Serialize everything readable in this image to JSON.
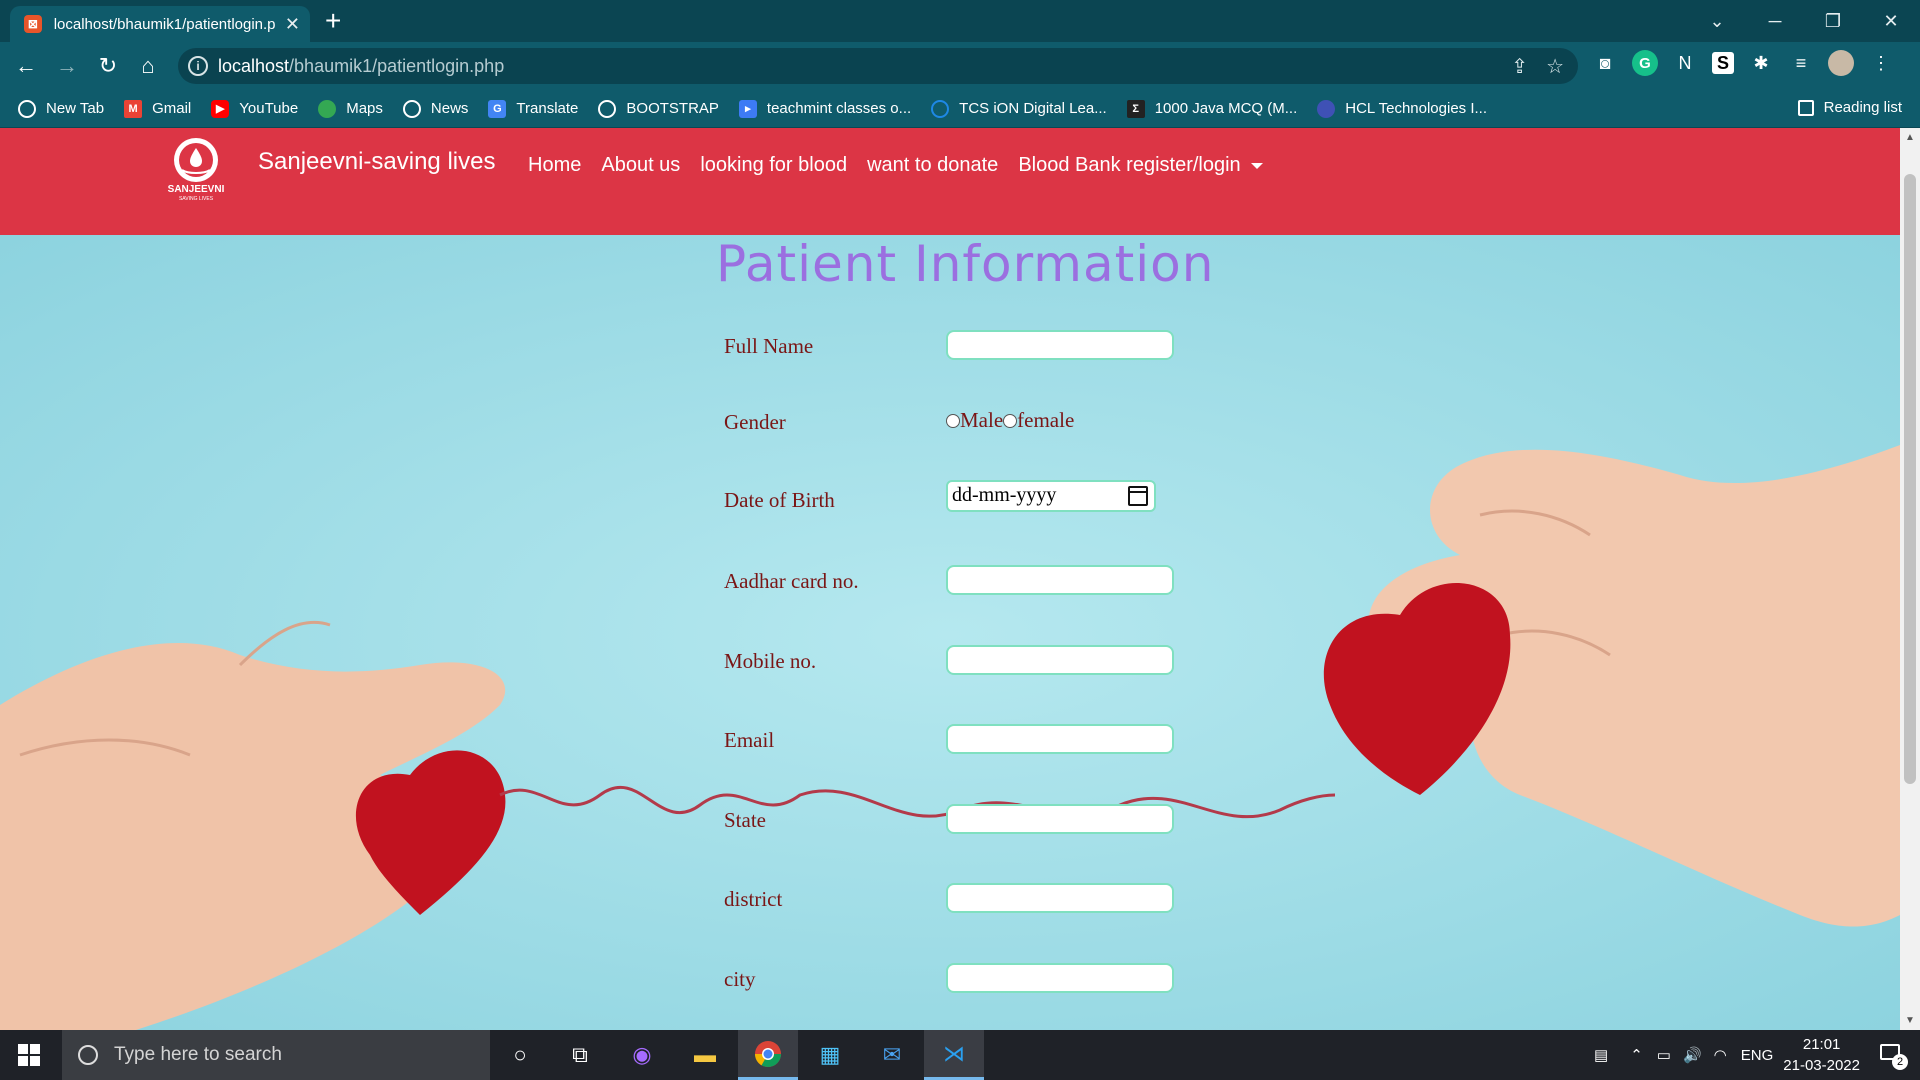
{
  "browser": {
    "tab_title": "localhost/bhaumik1/patientlogin.php",
    "url_host": "localhost",
    "url_path": "/bhaumik1/patientlogin.php",
    "bookmarks": [
      {
        "label": "New Tab",
        "color": "#ffffff"
      },
      {
        "label": "Gmail",
        "color": "#ea4335"
      },
      {
        "label": "YouTube",
        "color": "#ff0000"
      },
      {
        "label": "Maps",
        "color": "#34a853"
      },
      {
        "label": "News",
        "color": "#ffffff"
      },
      {
        "label": "Translate",
        "color": "#4285f4"
      },
      {
        "label": "BOOTSTRAP",
        "color": "#ffffff"
      },
      {
        "label": "teachmint classes o...",
        "color": "#3d7bf5"
      },
      {
        "label": "TCS iON Digital Lea...",
        "color": "#1e88e5"
      },
      {
        "label": "1000 Java MCQ (M...",
        "color": "#222222"
      },
      {
        "label": "HCL Technologies I...",
        "color": "#3f51b5"
      }
    ],
    "reading_list": "Reading list"
  },
  "site": {
    "brand": "Sanjeevni-saving lives",
    "logo_text": "SANJEEVNI",
    "logo_subtext": "SAVING LIVES",
    "nav": {
      "home": "Home",
      "about": "About us",
      "looking": "looking for blood",
      "donate": "want to donate",
      "bloodbank": "Blood Bank register/login"
    },
    "accent_color": "#dc3545"
  },
  "form": {
    "title": "Patient Information",
    "labels": {
      "full_name": "Full Name",
      "gender": "Gender",
      "dob": "Date of Birth",
      "aadhar": "Aadhar card no.",
      "mobile": "Mobile no.",
      "email": "Email",
      "state": "State",
      "district": "district",
      "city": "city"
    },
    "gender_options": {
      "male": "Male",
      "female": "female"
    },
    "dob_placeholder": "dd-mm-yyyy"
  },
  "taskbar": {
    "search_placeholder": "Type here to search",
    "language": "ENG",
    "time": "21:01",
    "date": "21-03-2022",
    "notification_count": "2"
  }
}
